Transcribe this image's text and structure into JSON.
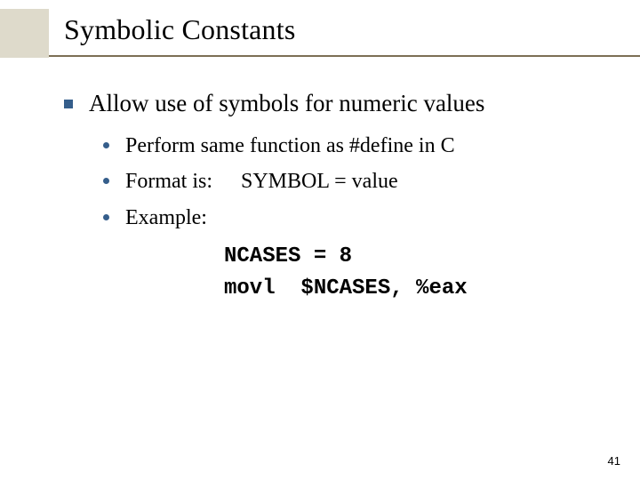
{
  "title": "Symbolic Constants",
  "main": {
    "point": "Allow use of symbols for numeric values",
    "subs": {
      "a": "Perform same function as #define in C",
      "b_label": "Format is:",
      "b_value": "SYMBOL = value",
      "c_label": "Example:"
    }
  },
  "code": {
    "line1": "NCASES = 8",
    "line2": "movl  $NCASES, %eax"
  },
  "page": "41"
}
